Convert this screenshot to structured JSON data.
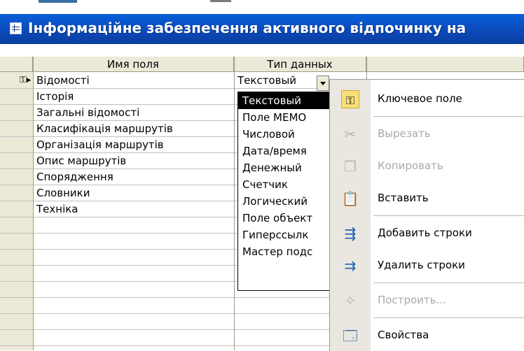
{
  "window": {
    "title": "Інформаційне забезпечення активного відпочинку на"
  },
  "table": {
    "headers": [
      "Имя поля",
      "Тип данных"
    ],
    "rows": [
      {
        "name": "Відомості",
        "type": "Текстовый"
      },
      {
        "name": "Історія",
        "type": ""
      },
      {
        "name": "Загальні відомості",
        "type": ""
      },
      {
        "name": "Класифікація маршрутів",
        "type": ""
      },
      {
        "name": "Організація маршрутів",
        "type": ""
      },
      {
        "name": "Опис маршрутів",
        "type": ""
      },
      {
        "name": "Спорядження",
        "type": ""
      },
      {
        "name": "Словники",
        "type": ""
      },
      {
        "name": "Техніка",
        "type": ""
      }
    ]
  },
  "dropdown": {
    "selected": "Текстовый",
    "options": [
      "Текстовый",
      "Поле МЕМО",
      "Числовой",
      "Дата/время",
      "Денежный",
      "Счетчик",
      "Логический",
      "Поле объект",
      "Гиперссылк",
      "Мастер подс"
    ]
  },
  "context_menu": {
    "items": [
      {
        "label": "Ключевое поле",
        "icon": "key-icon",
        "enabled": true
      },
      {
        "label": "Вырезать",
        "icon": "scissors-icon",
        "enabled": false
      },
      {
        "label": "Копировать",
        "icon": "copy-icon",
        "enabled": false
      },
      {
        "label": "Вставить",
        "icon": "paste-icon",
        "enabled": true
      },
      {
        "label": "Добавить строки",
        "icon": "insert-rows-icon",
        "enabled": true
      },
      {
        "label": "Удалить строки",
        "icon": "delete-rows-icon",
        "enabled": true
      },
      {
        "label": "Построить...",
        "icon": "build-icon",
        "enabled": false
      },
      {
        "label": "Свойства",
        "icon": "properties-icon",
        "enabled": true
      }
    ]
  },
  "colors": {
    "titlebar": "#0b48b8",
    "header_bg": "#ece9d8",
    "selected_bg": "#000000",
    "disabled_text": "#a9a9a9"
  }
}
